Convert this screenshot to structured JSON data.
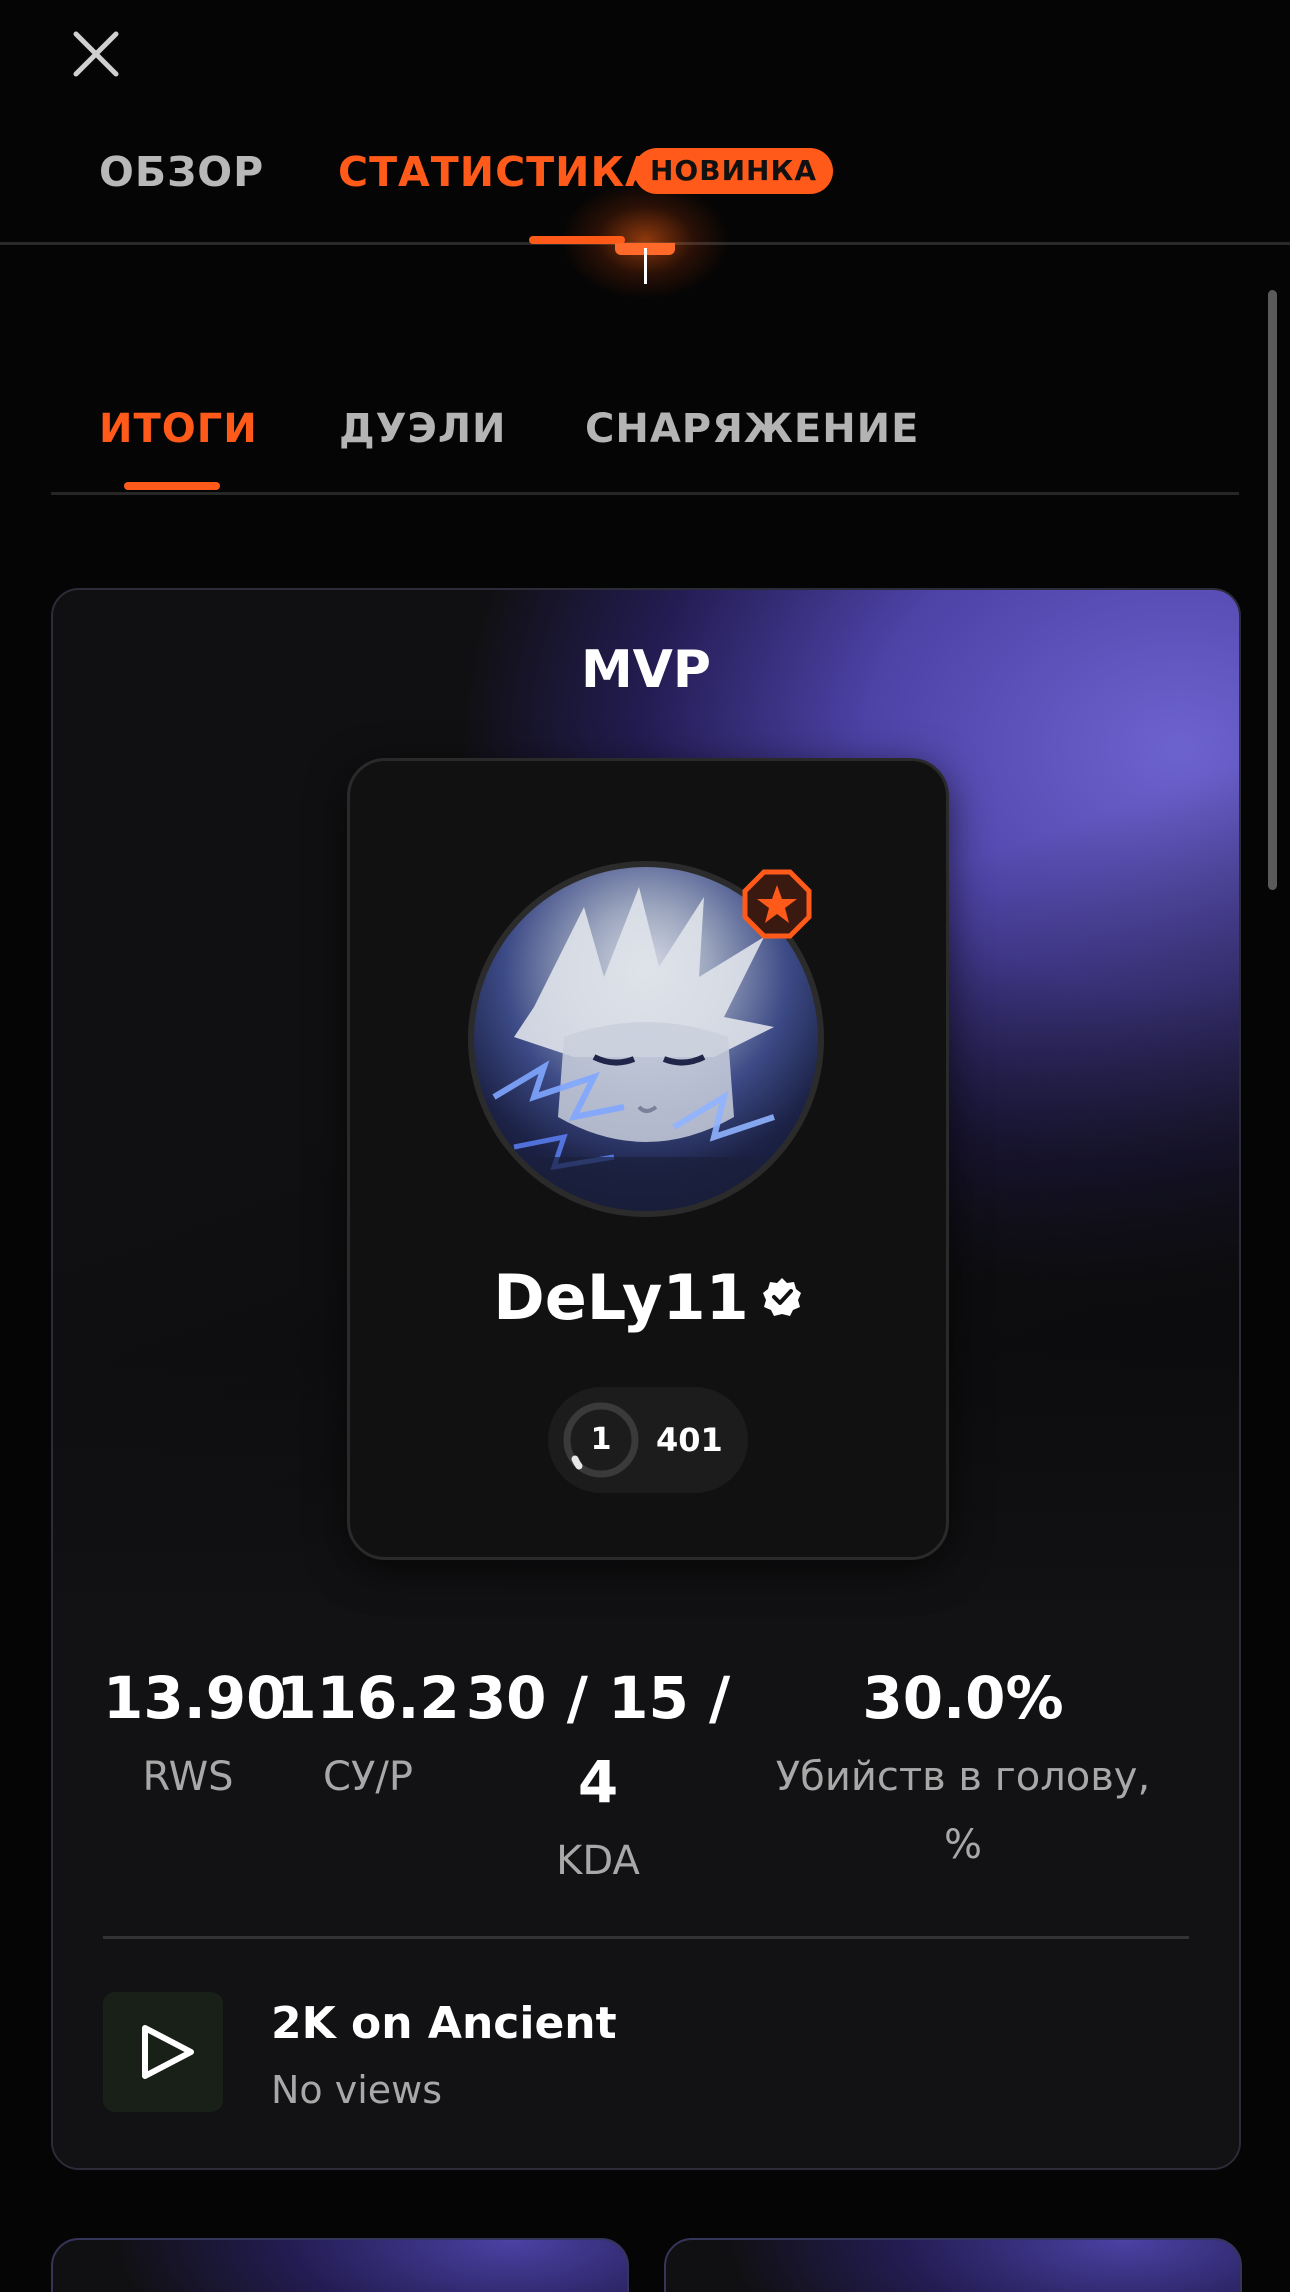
{
  "header": {
    "close_icon": "close-icon"
  },
  "top_tabs": {
    "overview": "ОБЗОР",
    "statistics": "СТАТИСТИКА",
    "new_badge": "НОВИНКА",
    "active": "statistics"
  },
  "sub_tabs": {
    "results": "ИТОГИ",
    "duels": "ДУЭЛИ",
    "equipment": "СНАРЯЖЕНИЕ",
    "active": "results"
  },
  "mvp": {
    "title": "MVP",
    "player": {
      "name": "DeLy11",
      "verified_icon": "verified-badge-icon",
      "level_badge_icon": "star-octagon-icon",
      "skill_level": "1",
      "elo": "401"
    },
    "stats": {
      "rws": {
        "value": "13.90",
        "label": "RWS"
      },
      "adr": {
        "value": "116.2",
        "label": "СУ/Р"
      },
      "kda": {
        "value_line1": "30 / 15 /",
        "value_line2": "4",
        "label": "KDA"
      },
      "headshots": {
        "value": "30.0%",
        "label_line1": "Убийств в голову,",
        "label_line2": "%"
      }
    },
    "highlight": {
      "play_icon": "play-icon",
      "title": "2K on Ancient",
      "views": "No views"
    }
  },
  "colors": {
    "accent": "#ff5a1a",
    "background": "#050505",
    "card_purple": "#6d63cf"
  }
}
